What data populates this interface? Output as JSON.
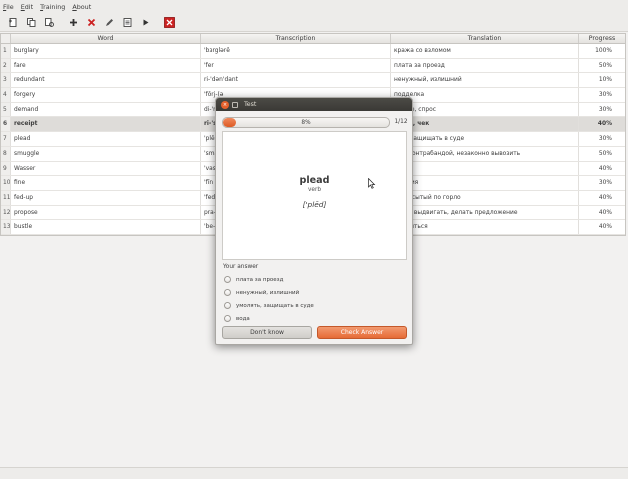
{
  "menu": {
    "file": "File",
    "edit": "Edit",
    "training": "Training",
    "about": "About"
  },
  "table": {
    "headers": [
      "Word",
      "Transcription",
      "Translation",
      "Progress"
    ],
    "rows": [
      [
        "1",
        "burglary",
        "'bɜrglərē",
        "кража со взломом",
        "100%"
      ],
      [
        "2",
        "fare",
        "'fer",
        "плата за проезд",
        "50%"
      ],
      [
        "3",
        "redundant",
        "ri-'dən'dant",
        "ненужный, излишний",
        "10%"
      ],
      [
        "4",
        "forgery",
        "'fōrj-(ə",
        "подделка",
        "30%"
      ],
      [
        "5",
        "demand",
        "di-'m",
        "...ание, спрос",
        "30%"
      ],
      [
        "6",
        "receipt",
        "ri-'sē",
        "...ние, чек",
        "40%"
      ],
      [
        "7",
        "plead",
        "'plēd",
        "...ть, защищать в суде",
        "30%"
      ],
      [
        "8",
        "smuggle",
        "'sma",
        "...ть контрабандой, незаконно вывозить",
        "50%"
      ],
      [
        "9",
        "Wasser",
        "'vase",
        "",
        "40%"
      ],
      [
        "10",
        "fine",
        "'fīn",
        "...ления",
        "30%"
      ],
      [
        "11",
        "fed-up",
        "'fed-'",
        "...ый, сытый по горло",
        "40%"
      ],
      [
        "12",
        "propose",
        "pra-'",
        "...ать, выдвигать, делать предложение",
        "40%"
      ],
      [
        "13",
        "bustle",
        "'be-s",
        "...уетиться",
        "40%"
      ]
    ],
    "selected_row": 5
  },
  "dialog": {
    "title": "Test",
    "progress_text": "8%",
    "progress_value": 0.08,
    "counter": "1/12",
    "word": "plead",
    "part_of_speech": "verb",
    "transcription": "['plēd]",
    "answer_label": "Your answer",
    "options": [
      "плата за проезд",
      "ненужный, излишний",
      "умолять, защищать в суде",
      "вода"
    ],
    "dont_know": "Don't know",
    "check_answer": "Check Answer"
  },
  "colors": {
    "accent": "#e66b36",
    "selected_row": "#dedcd9",
    "remove_icon": "#cc2222"
  },
  "icons": [
    "new-file-icon",
    "copy-icon",
    "open-icon",
    "add-icon",
    "delete-icon",
    "edit-icon",
    "list-icon",
    "play-icon",
    "close-app-icon"
  ]
}
